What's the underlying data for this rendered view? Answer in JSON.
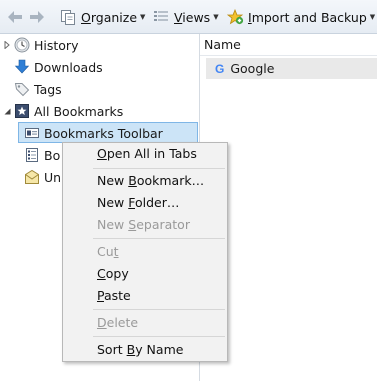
{
  "toolbar": {
    "back": "back-arrow",
    "forward": "forward-arrow",
    "organize": {
      "pre": "",
      "mn": "O",
      "rest": "rganize"
    },
    "views": {
      "pre": "",
      "mn": "V",
      "rest": "iews"
    },
    "import": {
      "pre": "",
      "mn": "I",
      "rest": "mport and Backup"
    }
  },
  "tree": [
    {
      "label": "History",
      "expander": "collapsed",
      "icon": "history-clock-icon"
    },
    {
      "label": "Downloads",
      "expander": "",
      "icon": "download-arrow-icon"
    },
    {
      "label": "Tags",
      "expander": "",
      "icon": "tag-icon"
    },
    {
      "label": "All Bookmarks",
      "expander": "expanded",
      "icon": "all-bookmarks-icon"
    },
    {
      "label": "Bookmarks Toolbar",
      "expander": "",
      "icon": "bookmarks-toolbar-icon",
      "selected": true
    },
    {
      "label": "Bo",
      "expander": "",
      "icon": "bookmarks-menu-icon"
    },
    {
      "label": "Un",
      "expander": "",
      "icon": "unsorted-bookmarks-icon"
    }
  ],
  "list": {
    "column_header": "Name",
    "rows": [
      {
        "label": "Google",
        "icon": "google-g-icon",
        "icon_glyph": "G"
      }
    ]
  },
  "context_menu": [
    {
      "pre": "",
      "mn": "O",
      "rest": "pen All in Tabs",
      "enabled": true
    },
    {
      "pre": "New ",
      "mn": "B",
      "rest": "ookmark…",
      "enabled": true
    },
    {
      "pre": "New ",
      "mn": "F",
      "rest": "older…",
      "enabled": true
    },
    {
      "pre": "New ",
      "mn": "S",
      "rest": "eparator",
      "enabled": false
    },
    {
      "pre": "Cu",
      "mn": "t",
      "rest": "",
      "enabled": false
    },
    {
      "pre": "",
      "mn": "C",
      "rest": "opy",
      "enabled": true
    },
    {
      "pre": "",
      "mn": "P",
      "rest": "aste",
      "enabled": true
    },
    {
      "pre": "",
      "mn": "D",
      "rest": "elete",
      "enabled": false
    },
    {
      "pre": "Sort ",
      "mn": "B",
      "rest": "y Name",
      "enabled": true
    }
  ],
  "colors": {
    "selection_bg": "#cce4f7",
    "selection_border": "#7fb6e6",
    "menu_bg": "#f2f2f2",
    "disabled_text": "#9a9a9a"
  }
}
